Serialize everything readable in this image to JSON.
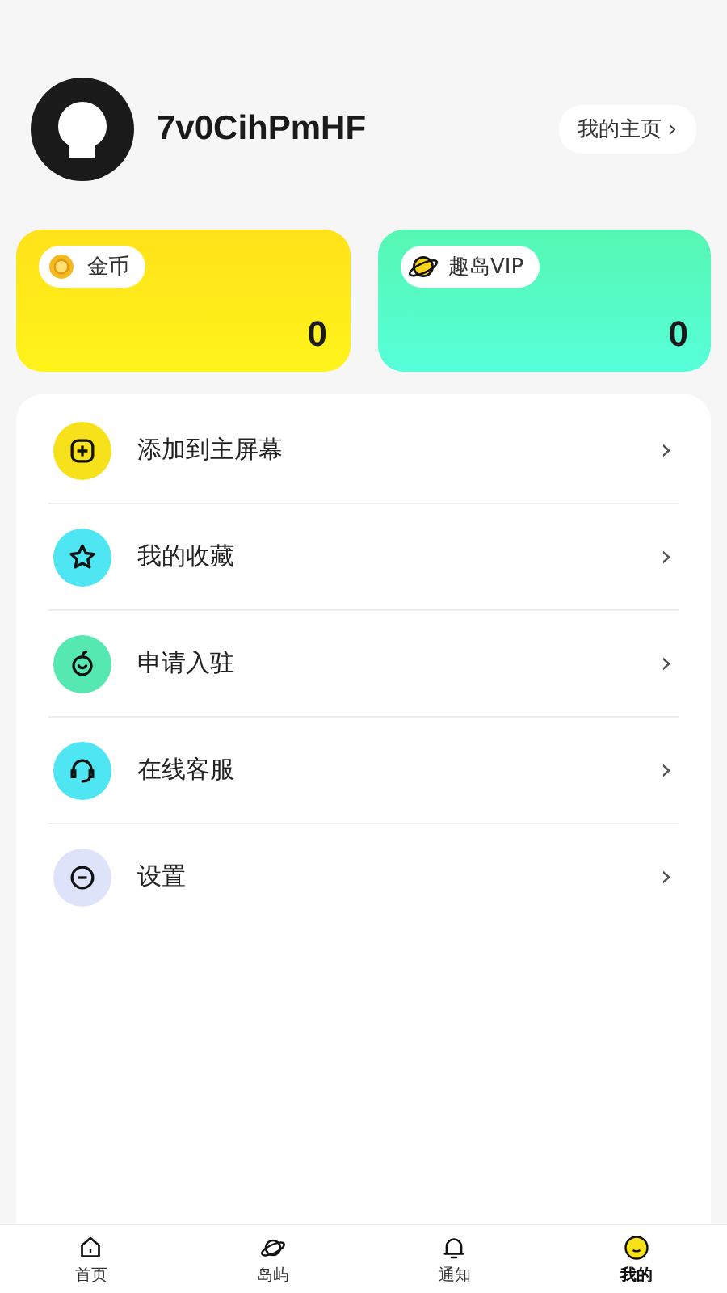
{
  "profile": {
    "username": "7v0CihPmHF",
    "homepage_link": "我的主页",
    "homepage_arrow": "›"
  },
  "cards": [
    {
      "kind": "coins",
      "label": "金币",
      "value": "0"
    },
    {
      "kind": "vip",
      "label": "趣岛VIP",
      "value": "0"
    }
  ],
  "menu": [
    {
      "kind": "add",
      "label": "添加到主屏幕",
      "color": "#f7e11b",
      "arrow": "›"
    },
    {
      "kind": "star",
      "label": "我的收藏",
      "color": "#4ee6f2",
      "arrow": "›"
    },
    {
      "kind": "sprout",
      "label": "申请入驻",
      "color": "#55e8b0",
      "arrow": "›"
    },
    {
      "kind": "headset",
      "label": "在线客服",
      "color": "#4ee6f2",
      "arrow": "›"
    },
    {
      "kind": "settings",
      "label": "设置",
      "color": "#dfe3fa",
      "arrow": "›"
    }
  ],
  "tabs": [
    {
      "kind": "home",
      "label": "首页",
      "selected": false
    },
    {
      "kind": "planet",
      "label": "岛屿",
      "selected": false
    },
    {
      "kind": "bell",
      "label": "通知",
      "selected": false
    },
    {
      "kind": "me",
      "label": "我的",
      "selected": true
    }
  ]
}
